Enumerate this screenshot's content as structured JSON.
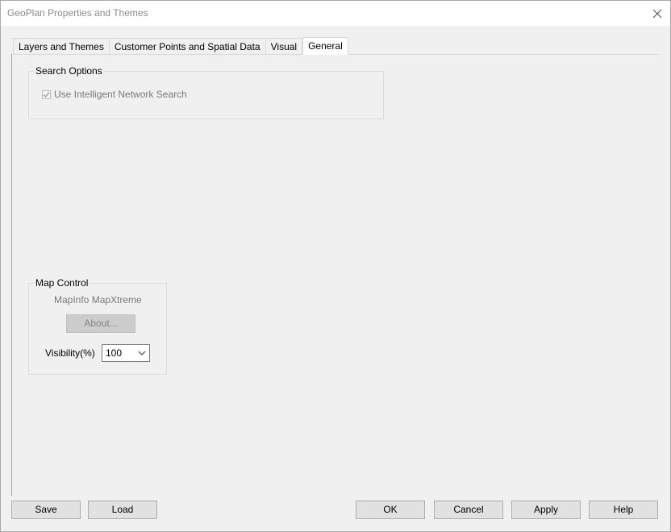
{
  "window": {
    "title": "GeoPlan Properties and Themes"
  },
  "tabs": [
    {
      "label": "Layers and Themes"
    },
    {
      "label": "Customer Points and Spatial Data"
    },
    {
      "label": "Visual"
    },
    {
      "label": "General"
    }
  ],
  "active_tab": "General",
  "search_options": {
    "title": "Search Options",
    "intelligent_search_label": "Use Intelligent Network Search",
    "intelligent_search_checked": true
  },
  "map_control": {
    "title": "Map Control",
    "product_name": "MapInfo MapXtreme",
    "about_label": "About...",
    "visibility_label": "Visibility(%)",
    "visibility_value": "100"
  },
  "buttons": {
    "save": "Save",
    "load": "Load",
    "ok": "OK",
    "cancel": "Cancel",
    "apply": "Apply",
    "help": "Help"
  },
  "icons": {
    "close": "close-icon",
    "dropdown": "chevron-down-icon",
    "check": "check-icon"
  },
  "colors": {
    "titlebar": "#ffffff",
    "background": "#f0f0f0",
    "disabled_text": "#7a7a7a"
  }
}
